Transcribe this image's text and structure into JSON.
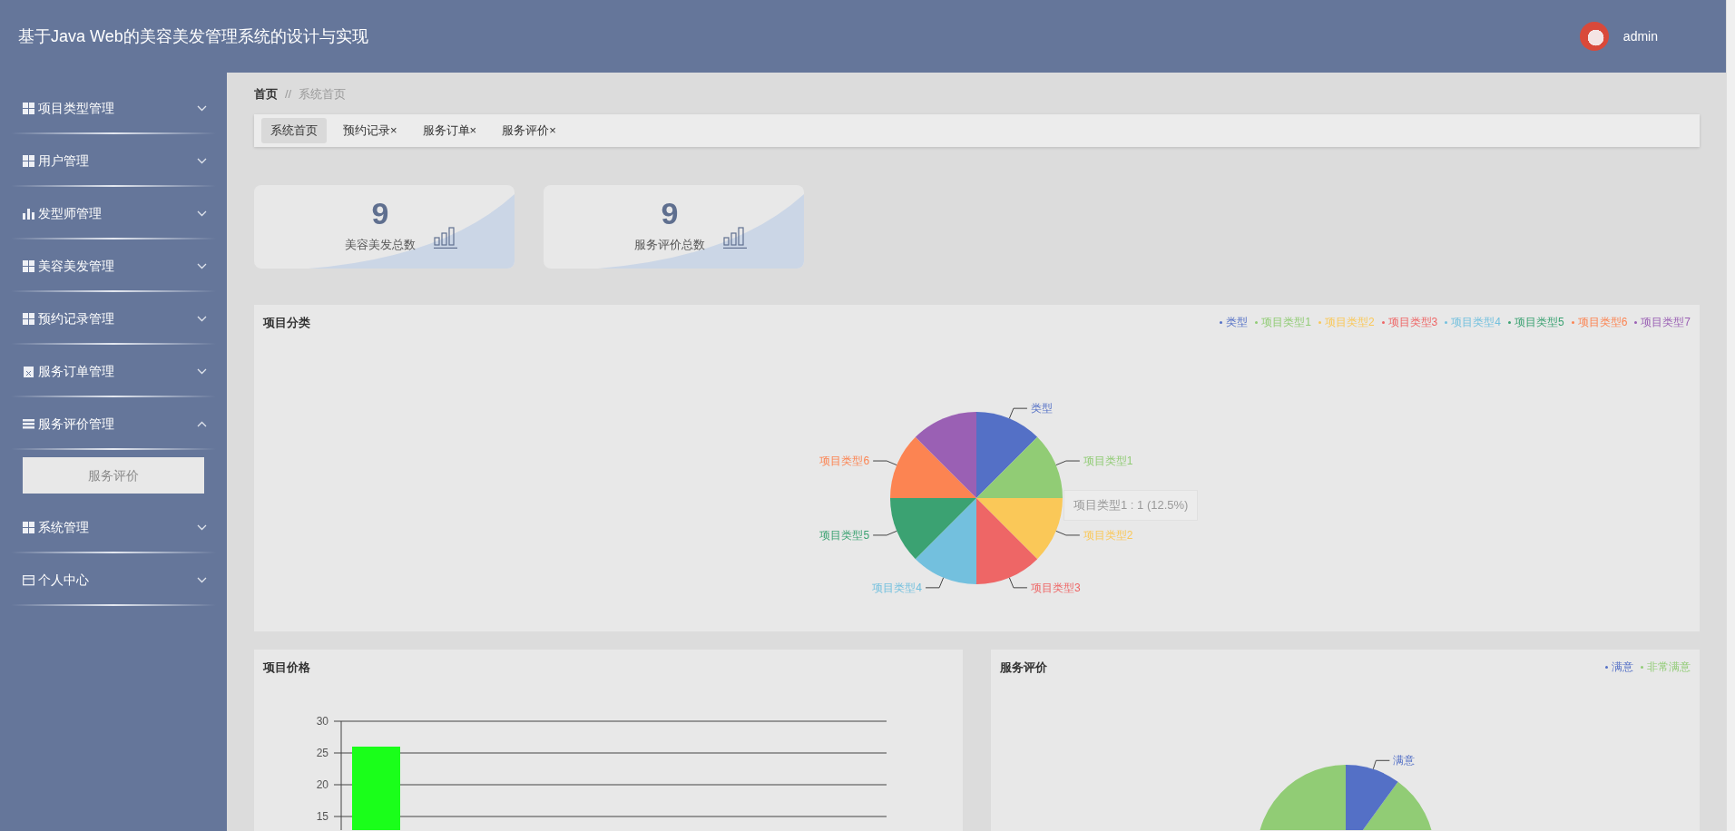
{
  "header": {
    "title": "基于Java Web的美容美发管理系统的设计与实现",
    "user": "admin"
  },
  "sidebar": {
    "items": [
      {
        "label": "项目类型管理",
        "expanded": false
      },
      {
        "label": "用户管理",
        "expanded": false
      },
      {
        "label": "发型师管理",
        "expanded": false
      },
      {
        "label": "美容美发管理",
        "expanded": false
      },
      {
        "label": "预约记录管理",
        "expanded": false
      },
      {
        "label": "服务订单管理",
        "expanded": false
      },
      {
        "label": "服务评价管理",
        "expanded": true,
        "children": [
          {
            "label": "服务评价"
          }
        ]
      },
      {
        "label": "系统管理",
        "expanded": false
      },
      {
        "label": "个人中心",
        "expanded": false
      }
    ]
  },
  "breadcrumb": {
    "home": "首页",
    "separator": "//",
    "current": "系统首页"
  },
  "tabs": [
    {
      "label": "系统首页",
      "selected": true
    },
    {
      "label": "预约记录",
      "close": "×",
      "selected": false
    },
    {
      "label": "服务订单",
      "close": "×",
      "selected": false
    },
    {
      "label": "服务评价",
      "close": "×",
      "selected": false
    }
  ],
  "stats": [
    {
      "value": "9",
      "label": "美容美发总数"
    },
    {
      "value": "9",
      "label": "服务评价总数"
    }
  ],
  "category_chart": {
    "chart_data": {
      "type": "pie",
      "title": "项目分类",
      "categories": [
        "类型",
        "项目类型1",
        "项目类型2",
        "项目类型3",
        "项目类型4",
        "项目类型5",
        "项目类型6",
        "项目类型7"
      ],
      "values": [
        1,
        1,
        1,
        1,
        1,
        1,
        1,
        1
      ],
      "colors": [
        "#5470c6",
        "#91cc75",
        "#fac858",
        "#ee6666",
        "#73c0de",
        "#3ba272",
        "#fc8452",
        "#9a60b4"
      ]
    },
    "slice_labels": [
      "类型",
      "项目类型1",
      "项目类型2",
      "项目类型3",
      "项目类型4",
      "项目类型5",
      "项目类型6"
    ],
    "tooltip": "项目类型1 : 1 (12.5%)"
  },
  "price_chart": {
    "chart_data": {
      "type": "bar",
      "title": "项目价格",
      "series": [
        {
          "color": "#1aff1a",
          "values": [
            26
          ]
        }
      ],
      "ylim": [
        12.86,
        30
      ],
      "yticks": [
        15,
        20,
        25,
        30
      ],
      "grid": true
    }
  },
  "rating_chart": {
    "title": "服务评价",
    "legend": [
      {
        "label": "满意",
        "color": "#5470c6"
      },
      {
        "label": "非常满意",
        "color": "#91cc75"
      }
    ],
    "slice_labels": [
      "满意"
    ]
  }
}
